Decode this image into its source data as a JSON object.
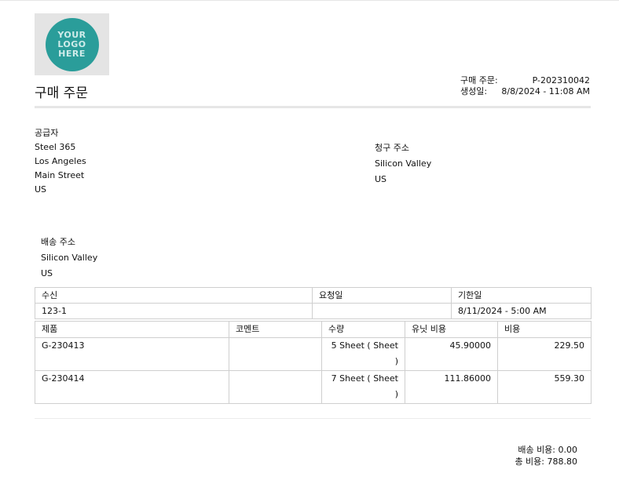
{
  "logo": {
    "text": "YOUR LOGO HERE",
    "color": "#2a9d9a"
  },
  "header": {
    "title": "구매 주문",
    "po_label": "구매 주문:",
    "po_value": "P-202310042",
    "created_label": "생성일:",
    "created_value": "8/8/2024 - 11:08 AM"
  },
  "supplier": {
    "heading": "공급자",
    "lines": [
      "Steel 365",
      "Los Angeles",
      "Main Street",
      "US"
    ]
  },
  "billing": {
    "heading": "청구 주소",
    "lines": [
      "Silicon Valley",
      "US"
    ]
  },
  "shipping": {
    "heading": "배송 주소",
    "lines": [
      "Silicon Valley",
      "US"
    ]
  },
  "info_table": {
    "headers": [
      "수신",
      "요청일",
      "기한일"
    ],
    "values": [
      "123-1",
      "",
      "8/11/2024 - 5:00 AM"
    ]
  },
  "items_table": {
    "headers": [
      "제품",
      "코멘트",
      "수량",
      "유닛 비용",
      "비용"
    ],
    "rows": [
      {
        "product": "G-230413",
        "comment": "",
        "qty": "5 Sheet ( Sheet )",
        "unit_cost": "45.90000",
        "cost": "229.50"
      },
      {
        "product": "G-230414",
        "comment": "",
        "qty": "7 Sheet ( Sheet )",
        "unit_cost": "111.86000",
        "cost": "559.30"
      }
    ]
  },
  "totals": {
    "shipping": "배송 비용: 0.00",
    "total": "총 비용: 788.80"
  }
}
